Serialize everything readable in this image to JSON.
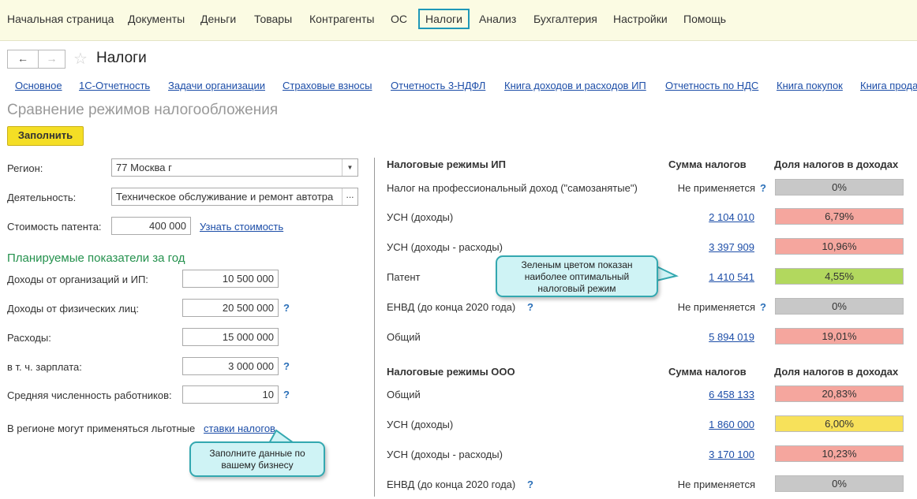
{
  "menu": [
    {
      "label": "Начальная страница"
    },
    {
      "label": "Документы"
    },
    {
      "label": "Деньги"
    },
    {
      "label": "Товары"
    },
    {
      "label": "Контрагенты"
    },
    {
      "label": "ОС"
    },
    {
      "label": "Налоги",
      "active": true
    },
    {
      "label": "Анализ"
    },
    {
      "label": "Бухгалтерия"
    },
    {
      "label": "Настройки"
    },
    {
      "label": "Помощь"
    }
  ],
  "nav": {
    "back": "←",
    "forward": "→",
    "star": "☆",
    "title": "Налоги"
  },
  "tabs": [
    "Основное",
    "1С-Отчетность",
    "Задачи организации",
    "Страховые взносы",
    "Отчетность 3-НДФЛ",
    "Книга доходов и расходов ИП",
    "Отчетность по НДС",
    "Книга покупок",
    "Книга прода"
  ],
  "page": {
    "subtitle": "Сравнение режимов налогообложения",
    "fill_button": "Заполнить"
  },
  "form": {
    "region_label": "Регион:",
    "region_value": "77 Москва г",
    "activity_label": "Деятельность:",
    "activity_value": "Техническое обслуживание и ремонт автотра",
    "activity_btn": "...",
    "patent_label": "Стоимость патента:",
    "patent_value": "400 000",
    "patent_link": "Узнать стоимость",
    "section_title": "Планируемые показатели за год",
    "income_org_label": "Доходы от организаций и ИП:",
    "income_org_value": "10 500 000",
    "income_ind_label": "Доходы от физических лиц:",
    "income_ind_value": "20 500 000",
    "expenses_label": "Расходы:",
    "expenses_value": "15 000 000",
    "salary_label": "в т. ч. зарплата:",
    "salary_value": "3 000 000",
    "staff_label": "Средняя численность работников:",
    "staff_value": "10",
    "help": "?",
    "rates_note": "В регионе могут применяться льготные",
    "rates_link": "ставки налогов"
  },
  "ip": {
    "header": {
      "name": "Налоговые режимы ИП",
      "sum": "Сумма налогов",
      "share": "Доля налогов в доходах"
    },
    "rows": [
      {
        "name": "Налог на профессиональный доход (\"самозанятые\")",
        "sum": "Не применяется",
        "share": "0%",
        "color": "#c8c8c8",
        "na": true,
        "qpos": "sum"
      },
      {
        "name": "УСН (доходы)",
        "sum": "2 104 010",
        "share": "6,79%",
        "color": "#f5a69e"
      },
      {
        "name": "УСН (доходы - расходы)",
        "sum": "3 397 909",
        "share": "10,96%",
        "color": "#f5a69e"
      },
      {
        "name": "Патент",
        "sum": "1 410 541",
        "share": "4,55%",
        "color": "#b2d85e"
      },
      {
        "name": "ЕНВД (до конца 2020 года)",
        "sum": "Не применяется",
        "share": "0%",
        "color": "#c8c8c8",
        "na": true,
        "qpos": "both"
      },
      {
        "name": "Общий",
        "sum": "5 894 019",
        "share": "19,01%",
        "color": "#f5a69e"
      }
    ]
  },
  "ooo": {
    "header": {
      "name": "Налоговые режимы ООО",
      "sum": "Сумма налогов",
      "share": "Доля налогов в доходах"
    },
    "rows": [
      {
        "name": "Общий",
        "sum": "6 458 133",
        "share": "20,83%",
        "color": "#f5a69e"
      },
      {
        "name": "УСН (доходы)",
        "sum": "1 860 000",
        "share": "6,00%",
        "color": "#f7e15a"
      },
      {
        "name": "УСН (доходы - расходы)",
        "sum": "3 170 100",
        "share": "10,23%",
        "color": "#f5a69e"
      },
      {
        "name": "ЕНВД (до конца 2020 года)",
        "sum": "Не применяется",
        "share": "0%",
        "color": "#c8c8c8",
        "na": true,
        "qpos": "name"
      }
    ]
  },
  "tooltips": {
    "green": "Зеленым цветом показан наиболее оптимальный налоговый режим",
    "fill": "Заполните данные по вашему бизнесу"
  }
}
